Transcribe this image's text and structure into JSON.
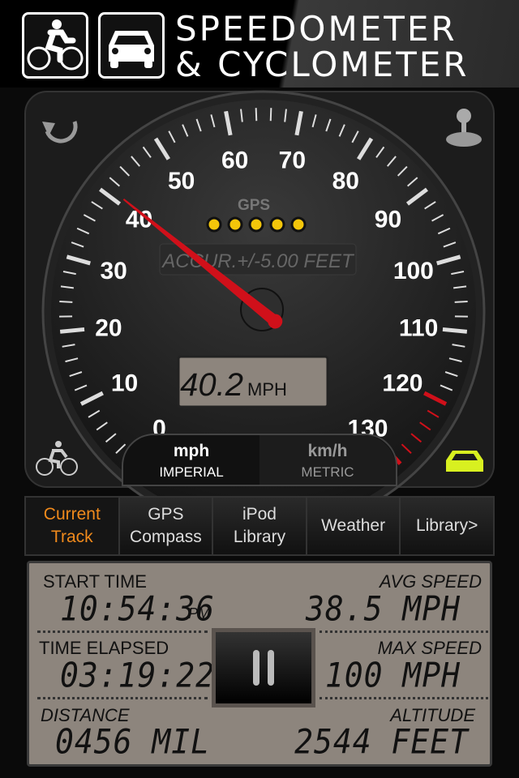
{
  "header": {
    "title_line1": "SPEEDOMETER",
    "title_line2": "& CYCLOMETER",
    "icons": [
      "bicycle-icon",
      "car-icon"
    ]
  },
  "gauge": {
    "min": 0,
    "max": 130,
    "labels": [
      "0",
      "10",
      "20",
      "30",
      "40",
      "50",
      "60",
      "70",
      "80",
      "90",
      "100",
      "110",
      "120",
      "130"
    ],
    "speed": 40.2,
    "gps_label": "GPS",
    "gps_signal_bars": 5,
    "accuracy": "ACCUR.+/-5.00 FEET",
    "digital_speed": "40.2",
    "digital_unit": "MPH",
    "needle_color": "#d0101a",
    "redline_from": 120,
    "mode_active": "car",
    "car_icon_color": "#d8f020"
  },
  "units": {
    "imperial_a": "mph",
    "imperial_b": "IMPERIAL",
    "metric_a": "km/h",
    "metric_b": "METRIC"
  },
  "tabs": [
    {
      "l1": "Current",
      "l2": "Track"
    },
    {
      "l1": "GPS",
      "l2": "Compass"
    },
    {
      "l1": "iPod",
      "l2": "Library"
    },
    {
      "l1": "Weather",
      "l2": ""
    },
    {
      "l1": "Library>",
      "l2": ""
    }
  ],
  "stats": {
    "start_time_label": "START TIME",
    "start_time": "10:54:36",
    "start_ampm": "PM",
    "avg_label": "AVG SPEED",
    "avg": "38.5 MPH",
    "elapsed_label": "TIME ELAPSED",
    "elapsed": "03:19:22",
    "max_label": "MAX SPEED",
    "max": "100 MPH",
    "distance_label": "DISTANCE",
    "distance": "0456 MIL",
    "altitude_label": "ALTITUDE",
    "altitude": "2544 FEET"
  },
  "accent": "#f08a1c"
}
